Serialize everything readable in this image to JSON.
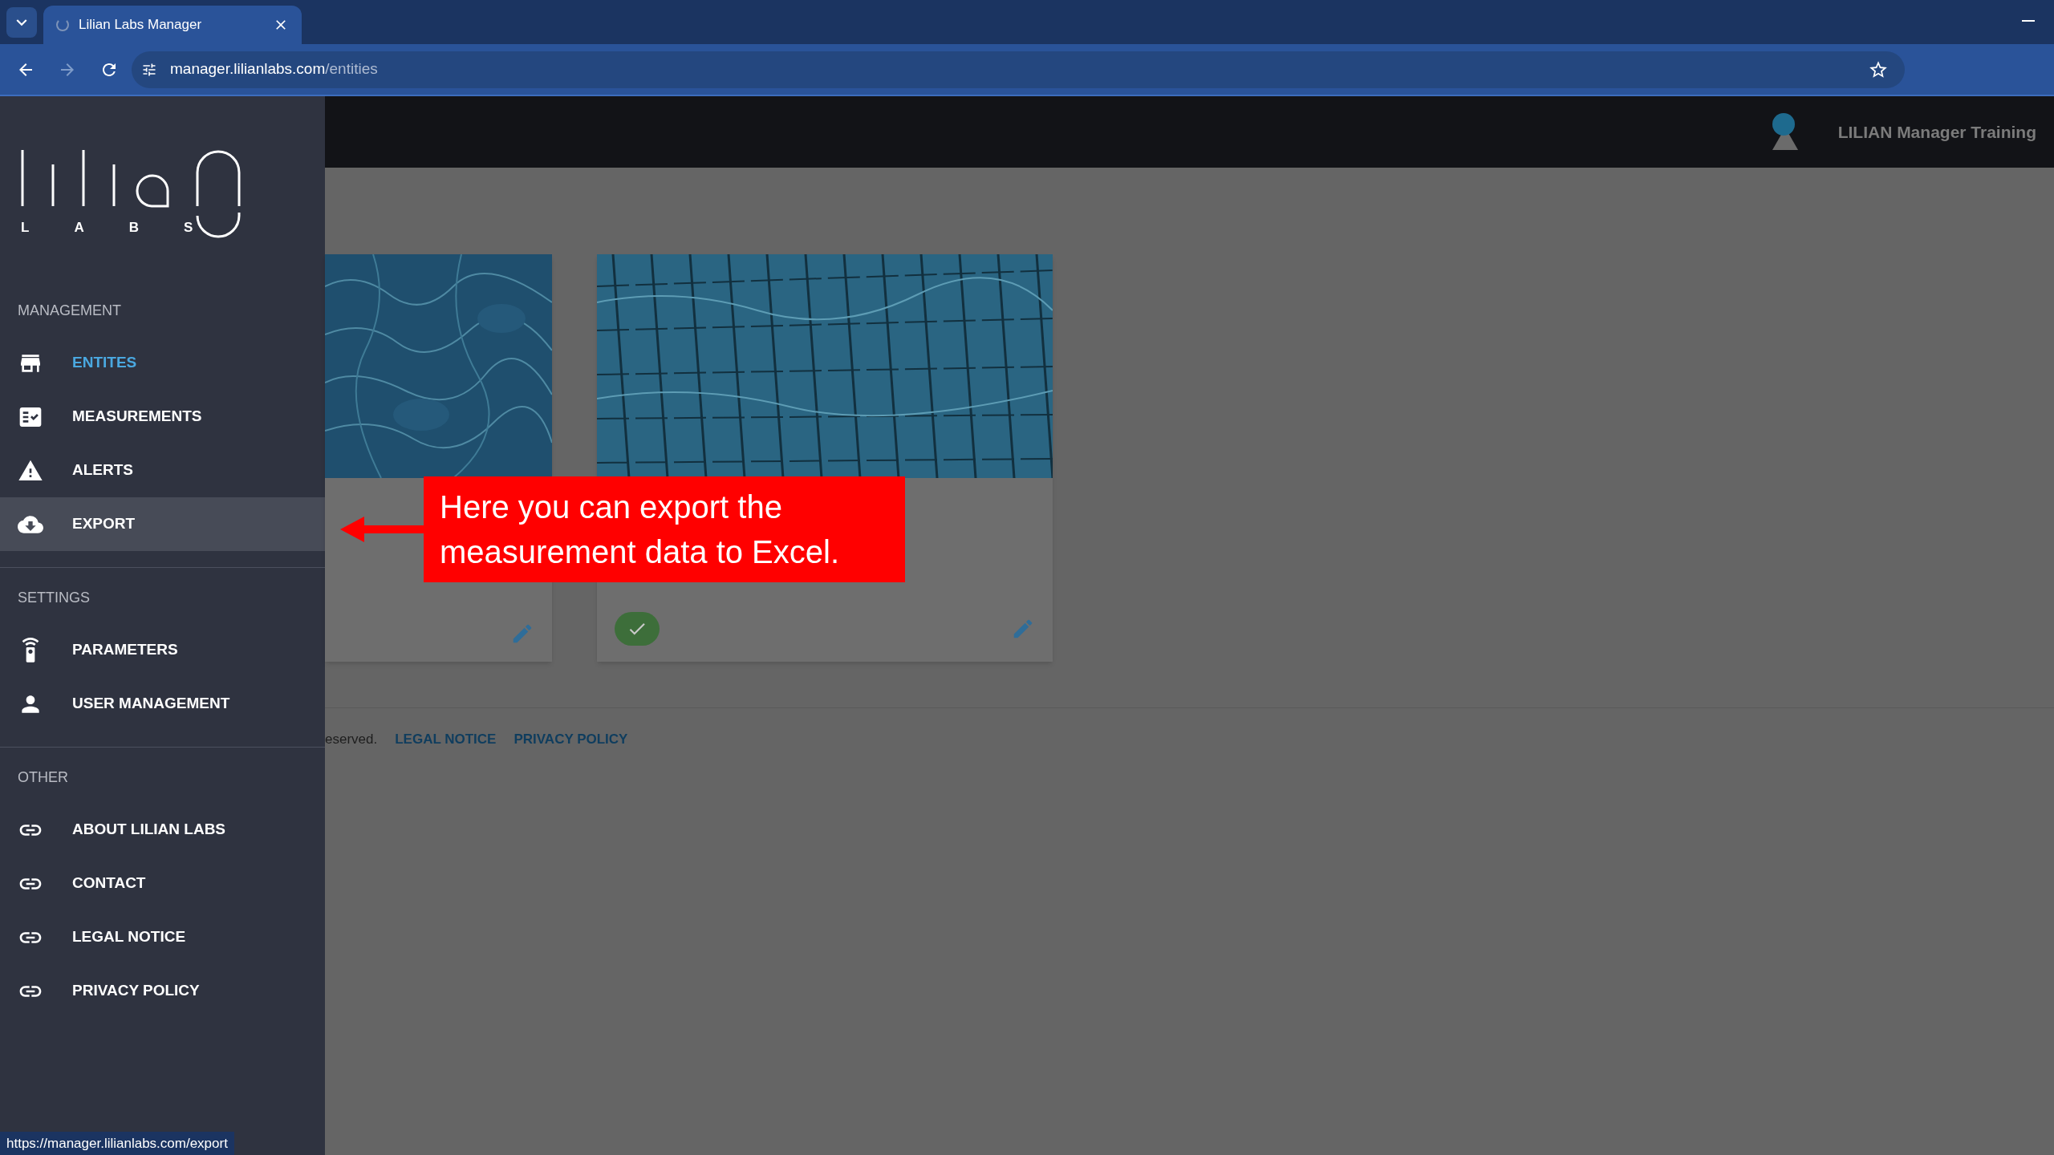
{
  "browser": {
    "tabs": [
      {
        "title": "Lilian Labs Manager",
        "selected": true
      }
    ],
    "url": {
      "host": "manager.lilianlabs.com",
      "path": "/entities"
    },
    "status_url": "https://manager.lilianlabs.com/export"
  },
  "header": {
    "user_name": "LILIAN Manager Training"
  },
  "sidebar": {
    "logo_caption": "LABS",
    "sections": [
      {
        "title": "MANAGEMENT",
        "items": [
          {
            "label": "ENTITES",
            "selected": true,
            "hovered": false
          },
          {
            "label": "MEASUREMENTS",
            "selected": false,
            "hovered": false
          },
          {
            "label": "ALERTS",
            "selected": false,
            "hovered": false
          },
          {
            "label": "EXPORT",
            "selected": false,
            "hovered": true
          }
        ]
      },
      {
        "title": "SETTINGS",
        "items": [
          {
            "label": "PARAMETERS",
            "selected": false,
            "hovered": false
          },
          {
            "label": "USER MANAGEMENT",
            "selected": false,
            "hovered": false
          }
        ]
      },
      {
        "title": "OTHER",
        "items": [
          {
            "label": "ABOUT LILIAN LABS",
            "selected": false,
            "hovered": false
          },
          {
            "label": "CONTACT",
            "selected": false,
            "hovered": false
          },
          {
            "label": "LEGAL NOTICE",
            "selected": false,
            "hovered": false
          },
          {
            "label": "PRIVACY POLICY",
            "selected": false,
            "hovered": false
          }
        ]
      }
    ]
  },
  "cards": [
    {
      "kind": "picture",
      "verified": false
    },
    {
      "kind": "picture",
      "verified": true
    }
  ],
  "footer": {
    "text": "eserved.",
    "links": [
      "LEGAL NOTICE",
      "PRIVACY POLICY"
    ]
  },
  "callout": {
    "text": "Here you can export the measurement data to Excel."
  }
}
